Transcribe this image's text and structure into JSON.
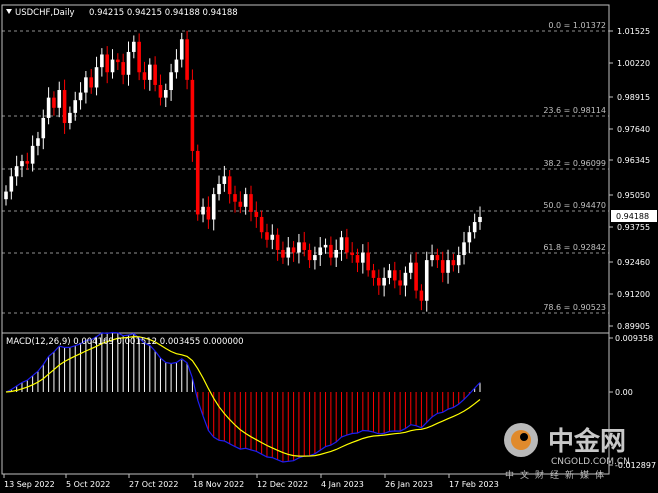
{
  "header": {
    "symbol": "USDCHF,Daily",
    "ohlc": "0.94215 0.94215 0.94188 0.94188"
  },
  "price_axis": {
    "labels": [
      "1.01525",
      "1.00220",
      "0.98915",
      "0.97640",
      "0.96345",
      "0.95050",
      "0.93755",
      "0.92460",
      "0.91200",
      "0.89905"
    ],
    "current_price": "0.94188"
  },
  "fibonacci": [
    {
      "label": "0.0 = 1.01372"
    },
    {
      "label": "23.6 = 0.98114"
    },
    {
      "label": "38.2 = 0.96099"
    },
    {
      "label": "50.0 = 0.94470"
    },
    {
      "label": "61.8 = 0.92842"
    },
    {
      "label": "78.6 = 0.90523"
    }
  ],
  "macd": {
    "header": "MACD(12,26,9) 0.004169 0.001512 0.003455 0.000000",
    "axis_labels": [
      "0.009358",
      "0.00",
      "-0.012897"
    ]
  },
  "time_axis": [
    "13 Sep 2022",
    "5 Oct 2022",
    "27 Oct 2022",
    "18 Nov 2022",
    "12 Dec 2022",
    "4 Jan 2023",
    "26 Jan 2023",
    "17 Feb 2023"
  ],
  "watermark": {
    "brand_cn": "中金网",
    "brand_en": "CNGOLD.COM.CN",
    "slogan": "中文财经新媒体"
  },
  "colors": {
    "background": "#000000",
    "bull": "#ffffff",
    "bear": "#ff0000",
    "macd_line": "#1e1ef0",
    "signal_line": "#ffff00",
    "fib": "#c0c0c0",
    "axis": "#c0c0c0"
  },
  "chart_data": {
    "type": "candlestick",
    "y_range": [
      0.89905,
      1.01525
    ],
    "notes": "Approximate daily closes read from the chart",
    "closes": [
      0.952,
      0.958,
      0.962,
      0.964,
      0.963,
      0.97,
      0.973,
      0.981,
      0.989,
      0.985,
      0.992,
      0.979,
      0.983,
      0.988,
      0.991,
      0.997,
      0.993,
      1.001,
      1.006,
      0.999,
      1.004,
      1.003,
      0.998,
      1.007,
      1.011,
      0.999,
      0.996,
      1.002,
      0.994,
      0.989,
      0.992,
      0.999,
      1.004,
      1.012,
      0.996,
      0.968,
      0.943,
      0.946,
      0.941,
      0.951,
      0.955,
      0.958,
      0.951,
      0.948,
      0.946,
      0.951,
      0.944,
      0.942,
      0.936,
      0.933,
      0.935,
      0.929,
      0.926,
      0.93,
      0.928,
      0.932,
      0.929,
      0.925,
      0.927,
      0.93,
      0.931,
      0.926,
      0.929,
      0.934,
      0.928,
      0.927,
      0.924,
      0.928,
      0.921,
      0.918,
      0.915,
      0.918,
      0.921,
      0.917,
      0.915,
      0.92,
      0.924,
      0.913,
      0.909,
      0.925,
      0.927,
      0.925,
      0.92,
      0.925,
      0.923,
      0.927,
      0.932,
      0.936,
      0.94,
      0.942
    ]
  }
}
